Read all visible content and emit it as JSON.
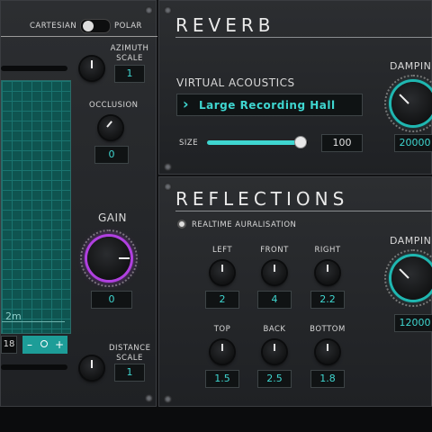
{
  "left": {
    "mode_toggle": {
      "left_label": "CARTESIAN",
      "right_label": "POLAR"
    },
    "azimuth_scale": {
      "label": "AZIMUTH\nSCALE",
      "value": "1"
    },
    "occlusion": {
      "label": "OCCLUSION",
      "value": "0"
    },
    "gain": {
      "label": "GAIN",
      "value": "0"
    },
    "distance_scale": {
      "label": "DISTANCE\nSCALE",
      "value": "1"
    },
    "grid_label": "2m",
    "zoom": {
      "value": "18",
      "minus": "–",
      "plus": "+"
    }
  },
  "reverb": {
    "title": "REVERB",
    "virtual_acoustics_label": "VIRTUAL ACOUSTICS",
    "preset": "Large Recording Hall",
    "size_label": "SIZE",
    "size_value": "100",
    "size_level": 0.88,
    "damping_label": "DAMPING",
    "damping_value": "20000"
  },
  "reflections": {
    "title": "REFLECTIONS",
    "realtime_label": "REALTIME AURALISATION",
    "knobs": [
      {
        "label": "LEFT",
        "value": "2"
      },
      {
        "label": "FRONT",
        "value": "4"
      },
      {
        "label": "RIGHT",
        "value": "2.2"
      },
      {
        "label": "TOP",
        "value": "1.5"
      },
      {
        "label": "BACK",
        "value": "2.5"
      },
      {
        "label": "BOTTOM",
        "value": "1.8"
      }
    ],
    "damping_label": "DAMPING",
    "damping_value": "12000"
  },
  "colors": {
    "accent": "#3fd6d0",
    "gain_ring": "#b040e0"
  }
}
